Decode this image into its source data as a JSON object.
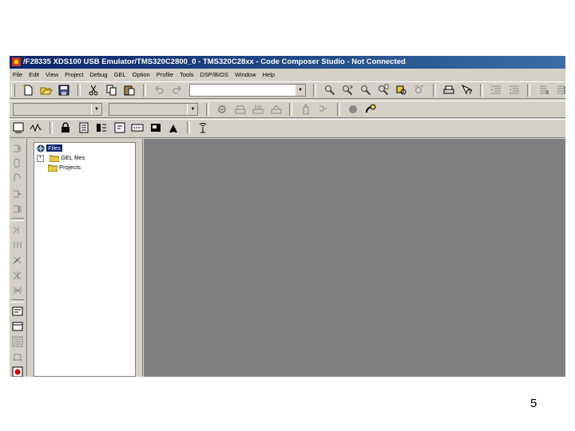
{
  "window": {
    "title": "/F28335 XDS100 USB Emulator/TMS320C2800_0 - TMS320C28xx - Code Composer Studio - Not Connected"
  },
  "menu": [
    "File",
    "Edit",
    "View",
    "Project",
    "Debug",
    "GEL",
    "Option",
    "Profile",
    "Tools",
    "DSP/BIOS",
    "Window",
    "Help"
  ],
  "toolbar1": {
    "icons": [
      "new-file-icon",
      "open-folder-icon",
      "save-icon",
      "cut-icon",
      "copy-icon",
      "paste-icon",
      "undo-icon",
      "redo-icon",
      "find-icon",
      "step-into-icon",
      "step-over-icon",
      "step-out-icon",
      "run-to-cursor-icon",
      "print-icon",
      "help-icon",
      "indent-icon",
      "outdent-icon",
      "bookmark-icon",
      "bookmark-next-icon",
      "window-icon",
      "list-icon",
      "edit-icon",
      "wand-icon",
      "tool-icon"
    ],
    "search_value": ""
  },
  "toolbar2": {
    "project_combo": "",
    "config_combo": ""
  },
  "project_view": {
    "root": "Files",
    "items": [
      "GEL files",
      "Projects"
    ]
  },
  "slide": {
    "page_number": "5"
  }
}
